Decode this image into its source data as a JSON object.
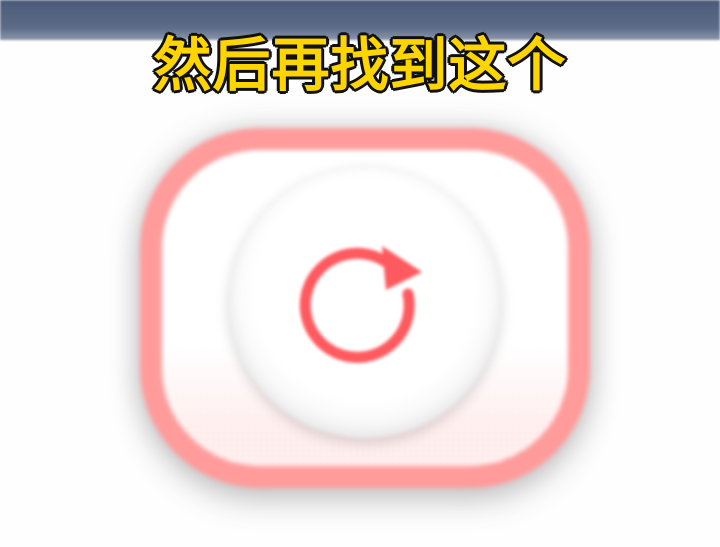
{
  "caption": {
    "text": "然后再找到这个"
  },
  "refresh_button": {
    "icon": "refresh-icon",
    "border_color": "#ff9b9b",
    "icon_color": "#ff5a5f"
  },
  "colors": {
    "caption_fill": "#ffd500",
    "caption_outline": "#111111",
    "top_bar": "#5d6c88"
  }
}
